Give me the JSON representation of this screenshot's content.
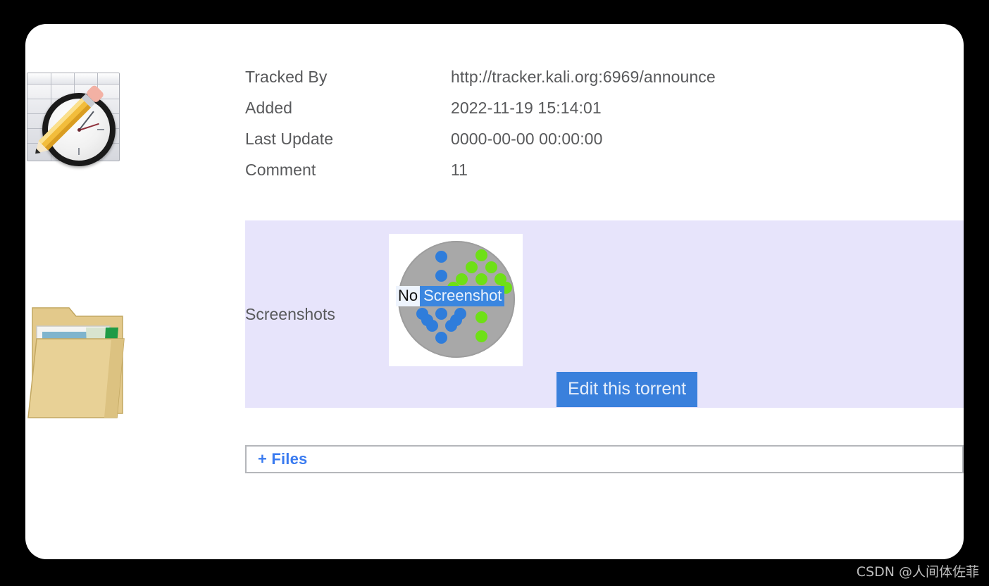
{
  "page": {
    "background_color": "#000000",
    "card_color": "#ffffff",
    "text_color": "#58595b",
    "accent_blue": "#3a7bf0",
    "selection_blue": "#3a80dc",
    "lavender_row": "#e7e4fb"
  },
  "icons": {
    "schedule": "schedule-pencil-clock-icon",
    "folder": "open-folder-documents-icon"
  },
  "details": {
    "rows": [
      {
        "label": "Tracked By",
        "value": "http://tracker.kali.org:6969/announce"
      },
      {
        "label": "Added",
        "value": "2022-11-19 15:14:01"
      },
      {
        "label": "Last Update",
        "value": "0000-00-00 00:00:00"
      },
      {
        "label": "Comment",
        "value": "11"
      }
    ]
  },
  "screenshots": {
    "label": "Screenshots",
    "thumbnail": {
      "alt_text_selected": "No",
      "alt_text_rest": "Screenshot",
      "full_alt_text": "No Screenshot",
      "icon_name": "torrent-up-down-arrows-icon",
      "disc_color": "#a8a8a8",
      "down_arrow_color": "#2f7ddb",
      "up_arrow_color": "#6ee016"
    },
    "edit_button_label": "Edit this torrent"
  },
  "files_section": {
    "toggle_label": "+ Files"
  },
  "watermark": {
    "text": "CSDN @人间体佐菲"
  }
}
